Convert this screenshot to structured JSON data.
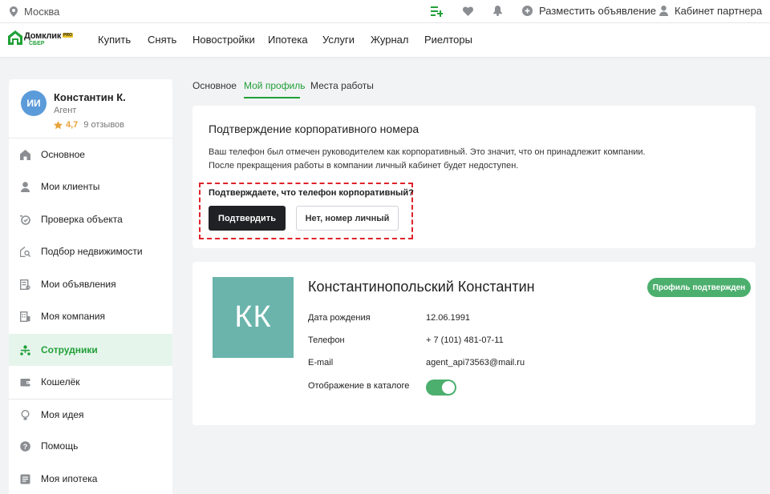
{
  "topbar": {
    "city": "Москва",
    "post_ad": "Разместить объявление",
    "partner_cabinet": "Кабинет партнера"
  },
  "logo": {
    "brand": "Домклик",
    "pro": "PRO",
    "sub": "СБЕР"
  },
  "nav": [
    "Купить",
    "Снять",
    "Новостройки",
    "Ипотека",
    "Услуги",
    "Журнал",
    "Риелторы"
  ],
  "user": {
    "initials": "ИИ",
    "name": "Константин К.",
    "role": "Агент",
    "rating": "4,7",
    "reviews": "9 отзывов"
  },
  "sidebar": [
    {
      "label": "Основное",
      "icon": "home-icon"
    },
    {
      "label": "Мои клиенты",
      "icon": "user-icon"
    },
    {
      "label": "Проверка объекта",
      "icon": "object-check-icon"
    },
    {
      "label": "Подбор недвижимости",
      "icon": "house-search-icon"
    },
    {
      "label": "Мои объявления",
      "icon": "listing-icon"
    },
    {
      "label": "Моя компания",
      "icon": "building-icon"
    },
    {
      "label": "Сотрудники",
      "icon": "employees-icon",
      "active": true
    },
    {
      "label": "Кошелёк",
      "icon": "wallet-icon"
    },
    {
      "label": "Моя идея",
      "icon": "lightbulb-icon"
    },
    {
      "label": "Помощь",
      "icon": "help-icon"
    },
    {
      "label": "Моя ипотека",
      "icon": "mortgage-icon"
    }
  ],
  "tabs": [
    {
      "label": "Основное"
    },
    {
      "label": "Мой профиль",
      "active": true
    },
    {
      "label": "Места работы"
    }
  ],
  "corporate": {
    "title": "Подтверждение корпоративного номера",
    "text_line1": "Ваш телефон был отмечен руководителем как корпоративный. Это значит, что он принадлежит компании.",
    "text_line2": "После прекращения работы в компании личный кабинет будет недоступен.",
    "question": "Подтверждаете, что телефон корпоративный?",
    "confirm": "Подтвердить",
    "decline": "Нет, номер личный"
  },
  "profile": {
    "initials": "КК",
    "full_name": "Константинопольский Константин",
    "badge": "Профиль подтвержден",
    "fields": [
      {
        "label": "Дата рождения",
        "value": "12.06.1991"
      },
      {
        "label": "Телефон",
        "value": "+ 7 (101) 481-07-11"
      },
      {
        "label": "E-mail",
        "value": "agent_api73563@mail.ru"
      }
    ],
    "catalog_label": "Отображение в каталоге",
    "catalog_visible": true
  },
  "colors": {
    "accent": "#21a038",
    "badge": "#4caf6e",
    "avatar": "#6ab4ab",
    "highlight": "#e0222a"
  }
}
